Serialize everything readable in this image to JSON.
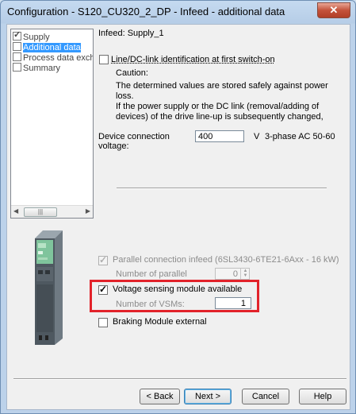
{
  "window": {
    "title": "Configuration - S120_CU320_2_DP - Infeed - additional data",
    "close_label": "✕"
  },
  "nav": {
    "items": [
      {
        "label": "Supply",
        "checked": true,
        "selected": false
      },
      {
        "label": "Additional data",
        "checked": false,
        "selected": true
      },
      {
        "label": "Process data exch",
        "checked": false,
        "selected": false
      },
      {
        "label": "Summary",
        "checked": false,
        "selected": false
      }
    ],
    "scroll_thumb": "|||"
  },
  "panel": {
    "heading": "Infeed: Supply_1",
    "line_dc_label": "Line/DC-link identification at first switch-on",
    "caution_label": "Caution:",
    "caution_lines": [
      "The determined values are stored safely against power",
      "loss.",
      "If the power supply or the DC link (removal/adding of",
      "devices) of the drive line-up is subsequently changed,"
    ],
    "device_voltage_label_1": "Device connection",
    "device_voltage_label_2": "voltage:",
    "device_voltage_value": "400",
    "device_voltage_unit": "V",
    "device_voltage_spec": "3-phase AC  50-60"
  },
  "lower": {
    "parallel_label": "Parallel connection infeed (6SL3430-6TE21-6Axx - 16 kW)",
    "parallel_number_label": "Number of parallel",
    "parallel_number_value": "0",
    "vsm_label": "Voltage sensing module available",
    "vsm_checked": true,
    "vsm_number_label": "Number of VSMs:",
    "vsm_number_value": "1",
    "braking_label": "Braking Module external",
    "highlight_color": "#e2222a"
  },
  "buttons": {
    "back": "< Back",
    "next": "Next >",
    "cancel": "Cancel",
    "help": "Help"
  }
}
